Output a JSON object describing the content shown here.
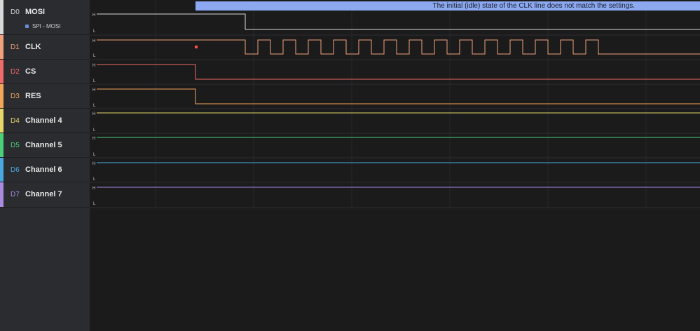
{
  "banner": {
    "message": "The initial (idle) state of the CLK line does not match the settings."
  },
  "level_labels": {
    "high": "H",
    "low": "L"
  },
  "channels": [
    {
      "id": "D0",
      "name": "MOSI",
      "color": "#d8d8d8",
      "analyzer": "SPI - MOSI",
      "analyzer_color": "#6b8fd8"
    },
    {
      "id": "D1",
      "name": "CLK",
      "color": "#f0a07a"
    },
    {
      "id": "D2",
      "name": "CS",
      "color": "#ef6a6a"
    },
    {
      "id": "D3",
      "name": "RES",
      "color": "#f2a65a"
    },
    {
      "id": "D4",
      "name": "Channel 4",
      "color": "#e9d66a"
    },
    {
      "id": "D5",
      "name": "Channel 5",
      "color": "#4bd07a"
    },
    {
      "id": "D6",
      "name": "Channel 6",
      "color": "#4aa8e0"
    },
    {
      "id": "D7",
      "name": "Channel 7",
      "color": "#a98be0"
    }
  ],
  "marker_color": "#ff4d4d"
}
